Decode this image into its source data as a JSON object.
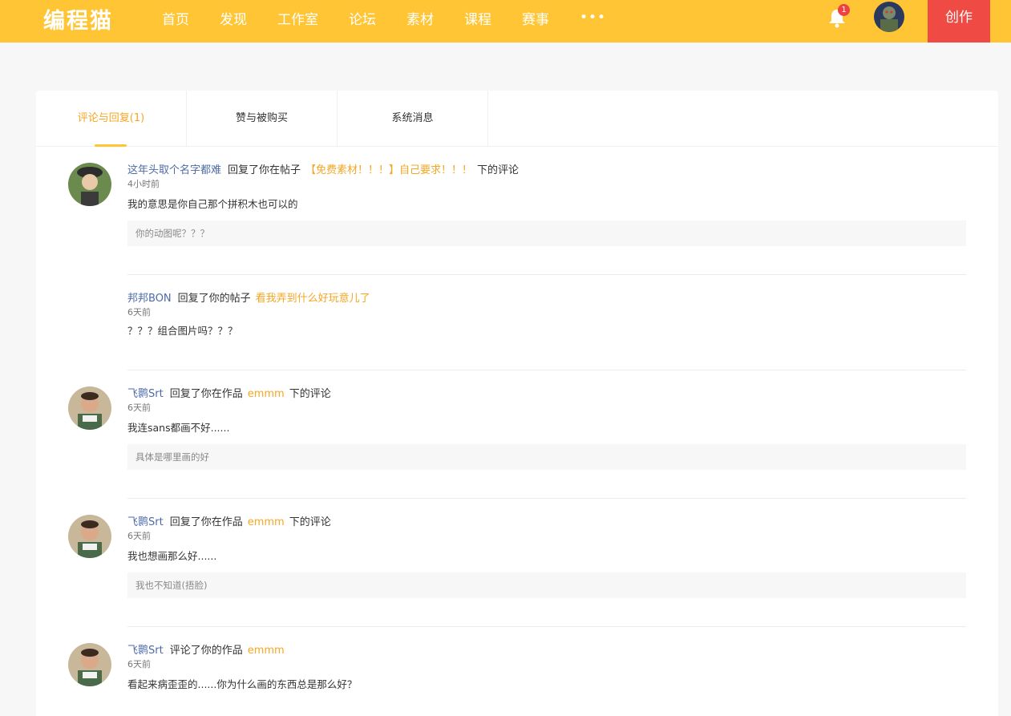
{
  "header": {
    "logo": "编程猫",
    "nav": [
      "首页",
      "发现",
      "工作室",
      "论坛",
      "素材",
      "课程",
      "赛事"
    ],
    "more": "•••",
    "notification_count": "1",
    "create_label": "创作"
  },
  "tabs": [
    {
      "label": "评论与回复(1)",
      "active": true
    },
    {
      "label": "赞与被购买",
      "active": false
    },
    {
      "label": "系统消息",
      "active": false
    }
  ],
  "messages": [
    {
      "user": "这年头取个名字都难",
      "action": "回复了你在帖子",
      "target": "【免费素材！！！】自己要求！！！",
      "suffix": "下的评论",
      "time": "4小时前",
      "content": "我的意思是你自己那个拼积木也可以的",
      "quote": "你的动图呢？？？"
    },
    {
      "user": "邦邦BON",
      "action": "回复了你的帖子",
      "target": "看我弄到什么好玩意儿了",
      "suffix": "",
      "time": "6天前",
      "content": "？？？组合图片吗？？？",
      "quote": ""
    },
    {
      "user": "飞鹮Srt",
      "action": "回复了你在作品",
      "target": "emmm",
      "suffix": "下的评论",
      "time": "6天前",
      "content": "我连sans都画不好......",
      "quote": "具体是哪里画的好"
    },
    {
      "user": "飞鹮Srt",
      "action": "回复了你在作品",
      "target": "emmm",
      "suffix": "下的评论",
      "time": "6天前",
      "content": "我也想画那么好......",
      "quote": "我也不知道(捂脸)"
    },
    {
      "user": "飞鹮Srt",
      "action": "评论了你的作品",
      "target": "emmm",
      "suffix": "",
      "time": "6天前",
      "content": "看起来病歪歪的......你为什么画的东西总是那么好？",
      "quote": ""
    }
  ],
  "colors": {
    "brand": "#ffc535",
    "create": "#f04a44",
    "link": "#4c6ba6",
    "highlight": "#f5a623"
  }
}
